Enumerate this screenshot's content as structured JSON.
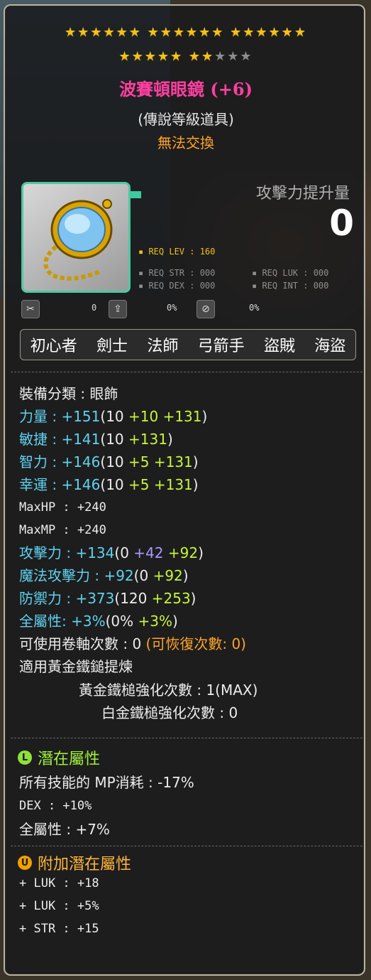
{
  "item": {
    "stars_row1": "★★★★★★ ★★★★★★ ★★★★★★",
    "stars_row2_on": "★★★★★ ★★",
    "stars_row2_off": "★★★",
    "name": "波賽頓眼鏡 (+6)",
    "grade": "(傳說等級道具)",
    "trade": "無法交換",
    "attack_increase_label": "攻擊力提升量",
    "attack_increase_value": "0"
  },
  "requirements": {
    "level": "REQ LEV : 160",
    "str": "REQ STR : 000",
    "luk": "REQ LUK : 000",
    "dex": "REQ DEX : 000",
    "int": "REQ INT : 000"
  },
  "mini_icons": {
    "v1": "0",
    "v2": "0%",
    "v3": "0%"
  },
  "jobs": [
    "初心者",
    "劍士",
    "法師",
    "弓箭手",
    "盜賊",
    "海盜"
  ],
  "stats": {
    "category": "裝備分類 : 眼飾",
    "str_label": "力量 : ",
    "str_total": "+151",
    "str_base": "(10 ",
    "str_b1": "+10",
    "str_b2": " +131",
    "str_end": ")",
    "dex_label": "敏捷 : ",
    "dex_total": "+141",
    "dex_base": "(10 ",
    "dex_b2": "+131",
    "dex_end": ")",
    "int_label": "智力 : ",
    "int_total": "+146",
    "int_base": "(10 ",
    "int_b1": "+5",
    "int_b2": " +131",
    "int_end": ")",
    "luk_label": "幸運 : ",
    "luk_total": "+146",
    "luk_base": "(10 ",
    "luk_b1": "+5",
    "luk_b2": " +131",
    "luk_end": ")",
    "maxhp": "MaxHP : +240",
    "maxmp": "MaxMP : +240",
    "atk_label": "攻擊力 : ",
    "atk_total": "+134",
    "atk_base": "(0 ",
    "atk_p": "+42",
    "atk_b2": " +92",
    "atk_end": ")",
    "matk_label": "魔法攻擊力 : ",
    "matk_total": "+92",
    "matk_base": "(0 ",
    "matk_b2": "+92",
    "matk_end": ")",
    "def_label": "防禦力 : ",
    "def_total": "+373",
    "def_base": "(120 ",
    "def_b2": "+253",
    "def_end": ")",
    "all_label": "全屬性: ",
    "all_total": "+3%",
    "all_base": "(0% ",
    "all_b2": "+3%",
    "all_end": ")",
    "scroll": "可使用卷軸次數 : 0 ",
    "scroll_recover": "(可恢復次數: 0)",
    "hammer": "適用黃金鐵鎚提煉",
    "gold_hammer": "黃金鐵槌強化次數 : 1(MAX)",
    "platinum_hammer": "白金鐵槌強化次數 : 0"
  },
  "potential": {
    "title": "潛在屬性",
    "badge": "L",
    "lines": [
      "所有技能的 MP消耗 : -17%",
      "DEX : +10%",
      "全屬性 : +7%"
    ]
  },
  "additional_potential": {
    "title": "附加潛在屬性",
    "badge": "U",
    "lines": [
      "+ LUK : +18",
      "+ LUK : +5%",
      "+ STR : +15"
    ]
  },
  "colors": {
    "name": "#ff3fa0",
    "untradeable": "#ffa32a",
    "stat_cyan": "#5fd2f0",
    "bonus_green": "#c8f53a",
    "star_gold": "#f2c21b",
    "potential_green": "#9ef03c",
    "additional_orange": "#ffb53c"
  },
  "icons": {
    "item": "monocle-icon",
    "flag": "flag-icon",
    "mini1": "scissors-icon",
    "mini2": "upload-icon",
    "mini3": "shield-slash-icon"
  }
}
